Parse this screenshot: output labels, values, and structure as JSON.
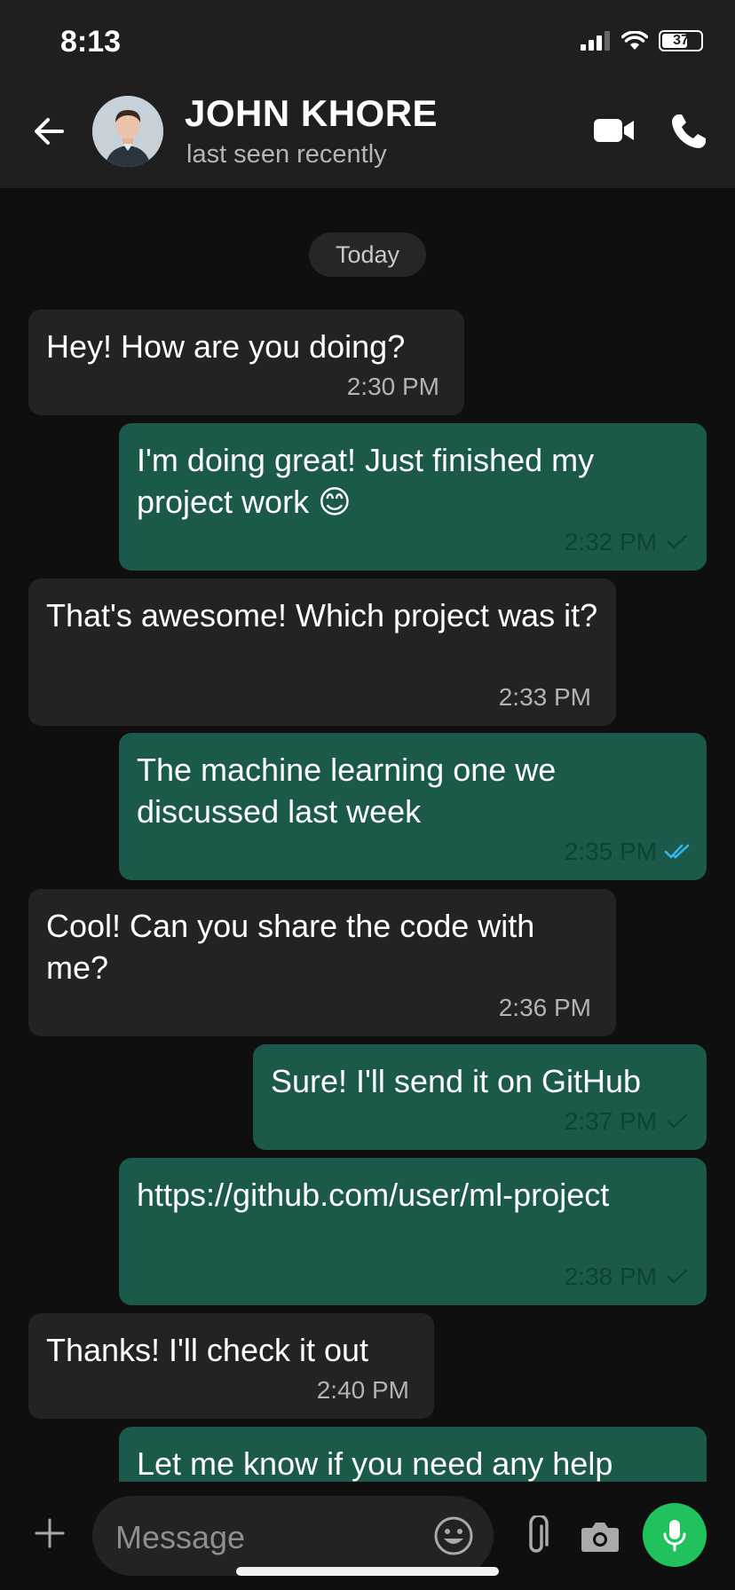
{
  "status_bar": {
    "time": "8:13",
    "battery": "37"
  },
  "header": {
    "contact_name": "JOHN KHORE",
    "contact_status": "last seen recently"
  },
  "date_separator": "Today",
  "messages": [
    {
      "direction": "in",
      "text": "Hey! How are you doing?",
      "time": "2:30 PM",
      "status": ""
    },
    {
      "direction": "out",
      "text": "I'm doing great! Just finished my project work 😊",
      "time": "2:32 PM",
      "status": "sent"
    },
    {
      "direction": "in",
      "text": "That's awesome! Which project was it?",
      "time": "2:33 PM",
      "status": ""
    },
    {
      "direction": "out",
      "text": "The machine learning one we discussed last week",
      "time": "2:35 PM",
      "status": "read"
    },
    {
      "direction": "in",
      "text": "Cool! Can you share the code with me?",
      "time": "2:36 PM",
      "status": ""
    },
    {
      "direction": "out",
      "text": "Sure! I'll send it on GitHub",
      "time": "2:37 PM",
      "status": "sent"
    },
    {
      "direction": "out",
      "text": "https://github.com/user/ml-project",
      "time": "2:38 PM",
      "status": "sent"
    },
    {
      "direction": "in",
      "text": "Thanks! I'll check it out",
      "time": "2:40 PM",
      "status": ""
    },
    {
      "direction": "out",
      "text": "Let me know if you need any help",
      "time": "",
      "status": ""
    }
  ],
  "composer": {
    "placeholder": "Message"
  },
  "colors": {
    "incoming_bubble": "#232323",
    "outgoing_bubble": "#1b5a4b",
    "mic_button": "#21c25e",
    "read_check": "#34b7f1"
  }
}
